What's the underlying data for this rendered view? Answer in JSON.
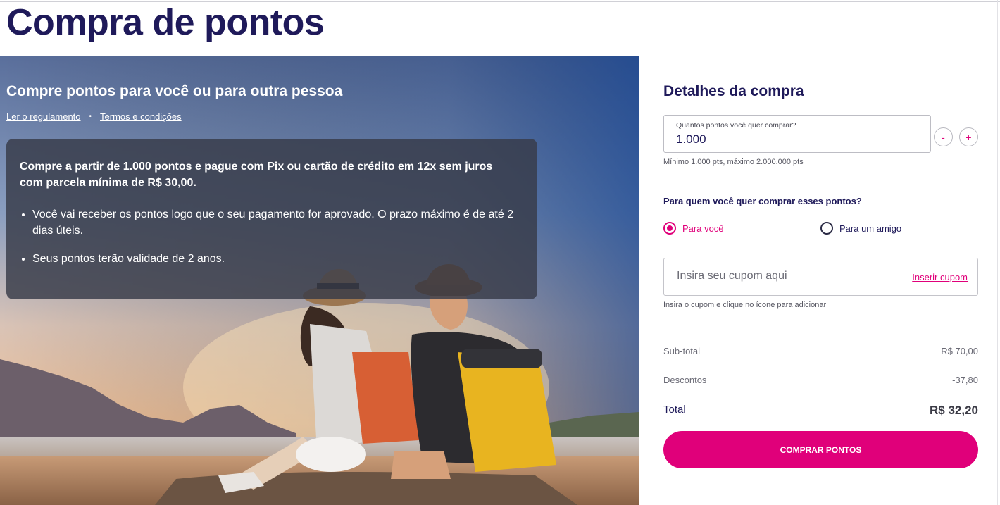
{
  "page": {
    "title": "Compra de pontos"
  },
  "hero": {
    "heading": "Compre pontos para você ou para outra pessoa",
    "links": {
      "regulation": "Ler o regulamento",
      "terms": "Termos e condições"
    },
    "info": {
      "lead": "Compre a partir de 1.000 pontos e pague com Pix ou cartão de crédito em 12x sem juros com parcela mínima de R$ 30,00.",
      "bullets": [
        "Você vai receber os pontos logo que o seu pagamento for aprovado. O prazo máximo é de até 2 dias úteis.",
        "Seus pontos terão validade de 2 anos."
      ]
    }
  },
  "panel": {
    "title": "Detalhes da compra",
    "points": {
      "label": "Quantos pontos você quer comprar?",
      "value": "1.000",
      "decrement": "-",
      "increment": "+",
      "hint": "Mínimo 1.000 pts, máximo 2.000.000 pts"
    },
    "recipient": {
      "question": "Para quem você quer comprar esses pontos?",
      "options": [
        {
          "label": "Para você",
          "selected": true
        },
        {
          "label": "Para um amigo",
          "selected": false
        }
      ]
    },
    "coupon": {
      "placeholder": "Insira seu cupom aqui",
      "apply_label": "Inserir cupom",
      "hint": "Insira o cupom e clique no ícone para adicionar"
    },
    "summary": {
      "subtotal_label": "Sub-total",
      "subtotal_value": "R$ 70,00",
      "discount_label": "Descontos",
      "discount_value": "-37,80",
      "total_label": "Total",
      "total_value": "R$ 32,20"
    },
    "buy_button": "COMPRAR PONTOS"
  },
  "colors": {
    "brand_navy": "#1f1a5a",
    "accent_magenta": "#e0007a"
  }
}
